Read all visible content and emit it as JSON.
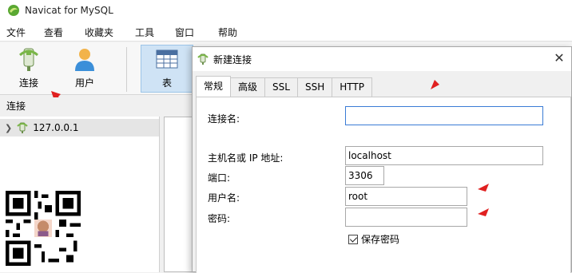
{
  "app": {
    "title": "Navicat for MySQL"
  },
  "menu": [
    "文件",
    "查看",
    "收藏夹",
    "工具",
    "窗口",
    "帮助"
  ],
  "toolbar": {
    "connect_label": "连接",
    "user_label": "用户",
    "table_label": "表"
  },
  "sidebar": {
    "header": "连接",
    "items": [
      {
        "label": "127.0.0.1"
      }
    ]
  },
  "dialog": {
    "title": "新建连接",
    "close_glyph": "✕",
    "tabs": [
      "常规",
      "高级",
      "SSL",
      "SSH",
      "HTTP"
    ],
    "active_tab": "常规",
    "fields": {
      "connection_name": {
        "label": "连接名:",
        "value": ""
      },
      "host": {
        "label": "主机名或 IP 地址:",
        "value": "localhost"
      },
      "port": {
        "label": "端口:",
        "value": "3306"
      },
      "username": {
        "label": "用户名:",
        "value": "root"
      },
      "password": {
        "label": "密码:",
        "value": ""
      }
    },
    "save_password": {
      "label": "保存密码",
      "checked": true
    }
  },
  "colors": {
    "accent": "#3a7bd5",
    "annotation_red": "#e02020",
    "selected_tool": "#cfe3f5"
  }
}
